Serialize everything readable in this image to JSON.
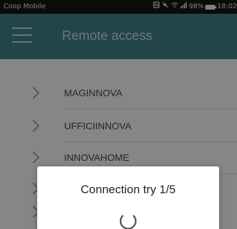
{
  "status_bar": {
    "carrier": "Coop Mobile",
    "signal_percent": "98%",
    "time": "18:02"
  },
  "app_bar": {
    "title": "Remote access"
  },
  "sites": [
    {
      "label": "MAGINNOVA"
    },
    {
      "label": "UFFICIINNOVA"
    },
    {
      "label": "INNOVAHOME"
    }
  ],
  "dialog": {
    "message": "Connection try 1/5"
  },
  "colors": {
    "app_bar": "#3f7f86",
    "chevron": "#5aa3ad",
    "status_bar": "#141414"
  }
}
